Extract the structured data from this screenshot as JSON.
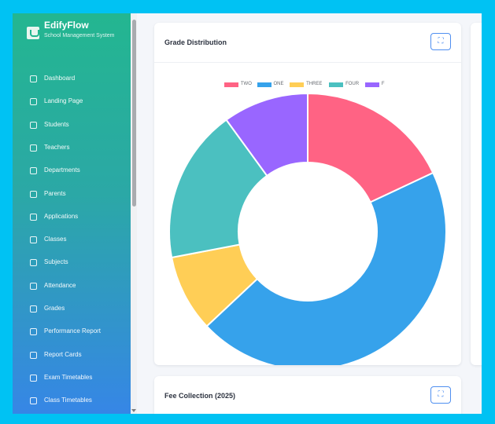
{
  "app": {
    "title": "EdifyFlow",
    "subtitle": "School Management System"
  },
  "sidebar": {
    "items": [
      {
        "label": "Dashboard",
        "icon": "dashboard-icon"
      },
      {
        "label": "Landing Page",
        "icon": "landing-page-icon"
      },
      {
        "label": "Students",
        "icon": "students-icon"
      },
      {
        "label": "Teachers",
        "icon": "teachers-icon"
      },
      {
        "label": "Departments",
        "icon": "departments-icon"
      },
      {
        "label": "Parents",
        "icon": "parents-icon"
      },
      {
        "label": "Applications",
        "icon": "applications-icon"
      },
      {
        "label": "Classes",
        "icon": "classes-icon"
      },
      {
        "label": "Subjects",
        "icon": "subjects-icon"
      },
      {
        "label": "Attendance",
        "icon": "attendance-icon"
      },
      {
        "label": "Grades",
        "icon": "grades-icon"
      },
      {
        "label": "Performance Report",
        "icon": "performance-report-icon"
      },
      {
        "label": "Report Cards",
        "icon": "report-cards-icon"
      },
      {
        "label": "Exam Timetables",
        "icon": "exam-timetables-icon"
      },
      {
        "label": "Class Timetables",
        "icon": "class-timetables-icon"
      }
    ]
  },
  "cards": {
    "grade": {
      "title": "Grade Distribution",
      "expand_icon": "expand-icon"
    },
    "fee": {
      "title": "Fee Collection (2025)",
      "expand_icon": "expand-icon"
    }
  },
  "chart_data": {
    "type": "pie",
    "title": "Grade Distribution",
    "donut": true,
    "legend_position": "top",
    "categories": [
      "TWO",
      "ONE",
      "THREE",
      "FOUR",
      "F"
    ],
    "values": [
      18,
      45,
      9,
      18,
      10
    ],
    "colors": [
      "#ff6384",
      "#36a2eb",
      "#ffce56",
      "#4bc0c0",
      "#9966ff"
    ]
  }
}
